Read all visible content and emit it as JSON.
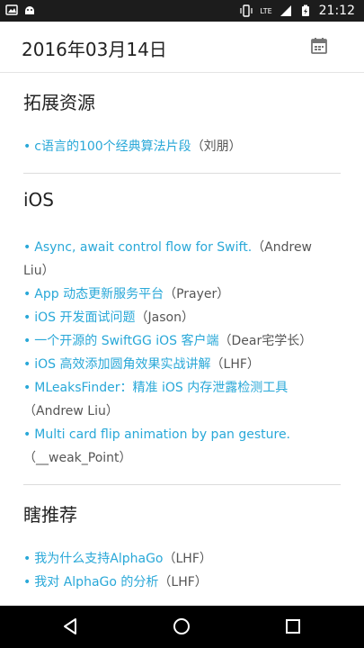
{
  "statusbar": {
    "time": "21:12",
    "network": "LTE"
  },
  "appbar": {
    "title": "2016年03月14日"
  },
  "sections": [
    {
      "title": "拓展资源",
      "items": [
        {
          "link": "c语言的100个经典算法片段",
          "author": "（刘朋）"
        }
      ]
    },
    {
      "title": "iOS",
      "items": [
        {
          "link": "Async, await control flow for Swift.",
          "author": "（Andrew Liu）"
        },
        {
          "link": "App 动态更新服务平台",
          "author": "（Prayer）"
        },
        {
          "link": "iOS 开发面试问题",
          "author": "（Jason）"
        },
        {
          "link": "一个开源的 SwiftGG iOS 客户端",
          "author": "（Dear宅学长）"
        },
        {
          "link": "iOS 高效添加圆角效果实战讲解",
          "author": "（LHF）"
        },
        {
          "link": "MLeaksFinder：精准 iOS 内存泄露检测工具",
          "author": "（Andrew Liu）"
        },
        {
          "link": "Multi card flip animation by pan gesture.",
          "author": "（__weak_Point）"
        }
      ]
    },
    {
      "title": "瞎推荐",
      "items": [
        {
          "link": "我为什么支持AlphaGo",
          "author": "（LHF）"
        },
        {
          "link": "我对 AlphaGo 的分析",
          "author": "（LHF）"
        }
      ]
    }
  ],
  "icons": {
    "calendar": "calendar-icon",
    "back": "back-icon",
    "home": "home-icon",
    "recents": "recents-icon"
  }
}
